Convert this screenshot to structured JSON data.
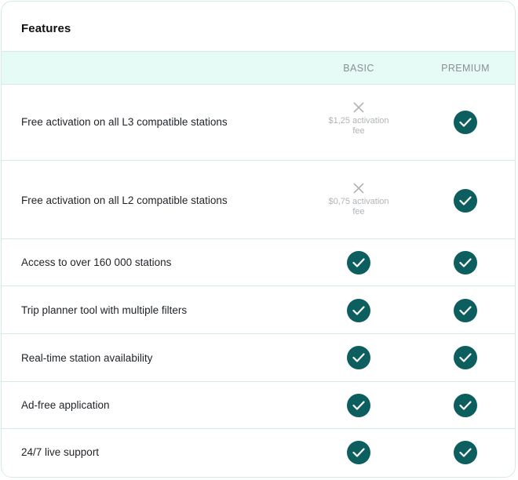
{
  "header": {
    "title": "Features"
  },
  "columns": {
    "basic": "BASIC",
    "premium": "PREMIUM"
  },
  "rows": [
    {
      "label": "Free activation on all L3 compatible stations",
      "basic": {
        "included": false,
        "note": "$1,25 activation fee"
      },
      "premium": {
        "included": true
      }
    },
    {
      "label": "Free activation on all L2 compatible stations",
      "basic": {
        "included": false,
        "note": "$0,75 activation fee"
      },
      "premium": {
        "included": true
      }
    },
    {
      "label": "Access to over 160 000 stations",
      "basic": {
        "included": true
      },
      "premium": {
        "included": true
      }
    },
    {
      "label": "Trip planner tool with multiple filters",
      "basic": {
        "included": true
      },
      "premium": {
        "included": true
      }
    },
    {
      "label": "Real-time station availability",
      "basic": {
        "included": true
      },
      "premium": {
        "included": true
      }
    },
    {
      "label": "Ad-free application",
      "basic": {
        "included": true
      },
      "premium": {
        "included": true
      }
    },
    {
      "label": "24/7 live support",
      "basic": {
        "included": true
      },
      "premium": {
        "included": true
      }
    }
  ],
  "icons": {
    "included": "check-circle-icon",
    "excluded": "x-icon"
  },
  "colors": {
    "check": "#0d5f5f",
    "header_bg": "#e6fbf6",
    "border": "#d6ebe6",
    "muted": "#b0b4b7"
  }
}
